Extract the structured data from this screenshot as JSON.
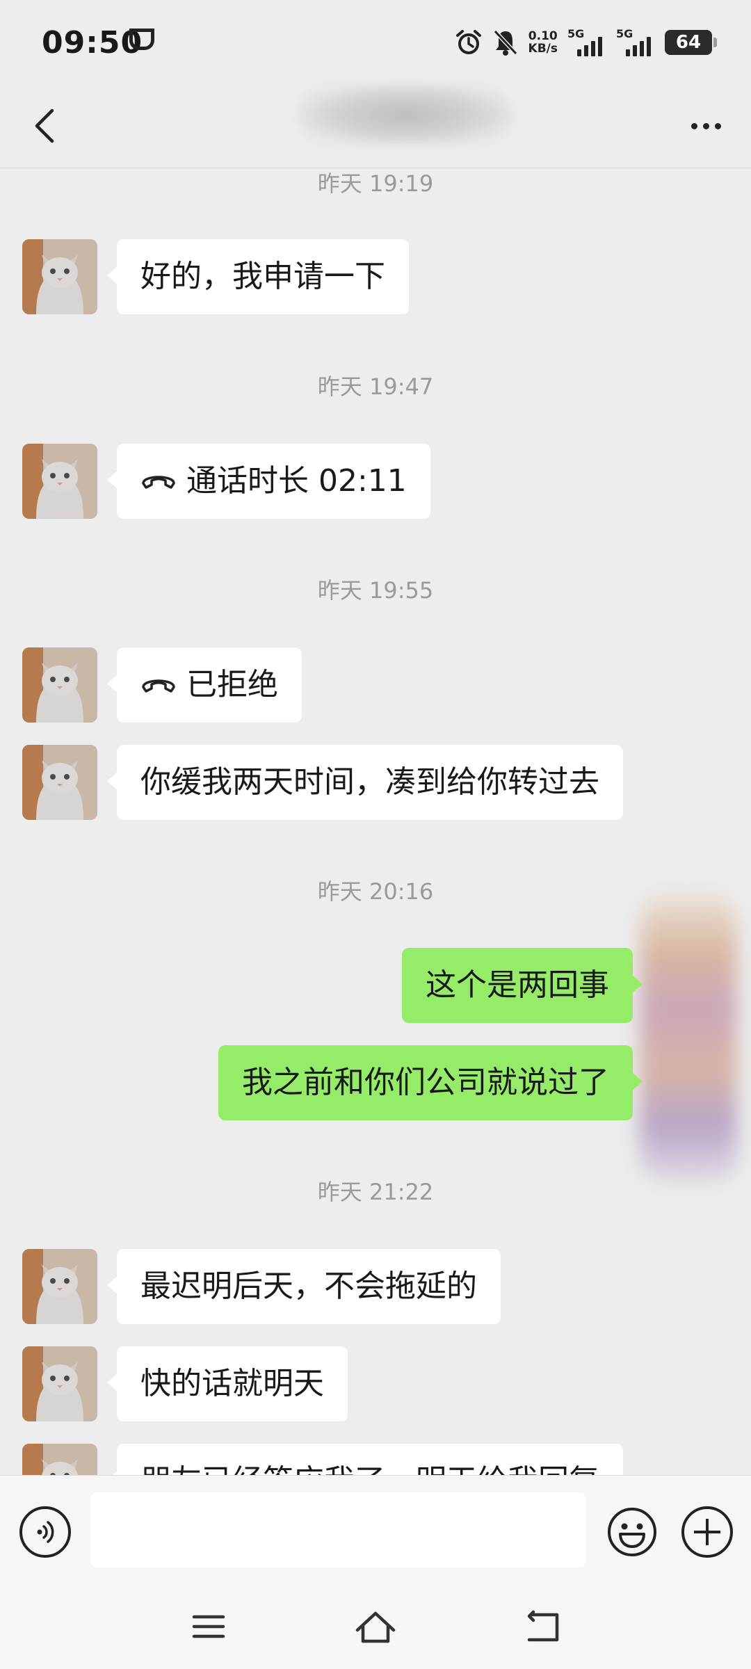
{
  "status_bar": {
    "time": "09:50",
    "net_speed_value": "0.10",
    "net_speed_unit": "KB/s",
    "sim1_label": "5G",
    "sim2_label": "5G",
    "battery": "64"
  },
  "header": {
    "contact_name": ""
  },
  "messages": [
    {
      "type": "timestamp",
      "text": "昨天 19:19"
    },
    {
      "type": "in",
      "text": "好的，我申请一下"
    },
    {
      "type": "timestamp",
      "text": "昨天 19:47"
    },
    {
      "type": "in-call",
      "text": "通话时长 02:11"
    },
    {
      "type": "timestamp",
      "text": "昨天 19:55"
    },
    {
      "type": "in-call",
      "text": "已拒绝"
    },
    {
      "type": "in",
      "text": "你缓我两天时间，凑到给你转过去"
    },
    {
      "type": "timestamp",
      "text": "昨天 20:16"
    },
    {
      "type": "out",
      "text": "这个是两回事"
    },
    {
      "type": "out",
      "text": "我之前和你们公司就说过了"
    },
    {
      "type": "timestamp",
      "text": "昨天 21:22"
    },
    {
      "type": "in",
      "text": "最迟明后天，不会拖延的"
    },
    {
      "type": "in",
      "text": "快的话就明天"
    },
    {
      "type": "in",
      "text": "朋友已经答应我了，明天给我回复"
    }
  ],
  "input_bar": {
    "placeholder": "",
    "value": ""
  },
  "icons": {
    "back": "chevron-left-icon",
    "more": "more-dots-icon",
    "voice": "voice-icon",
    "emoji": "emoji-icon",
    "plus": "plus-icon",
    "call": "phone-call-icon",
    "nav_menu": "menu-icon",
    "nav_home": "home-icon",
    "nav_back": "return-icon"
  },
  "colors": {
    "background": "#ededed",
    "bubble_incoming": "#ffffff",
    "bubble_outgoing": "#95ec69",
    "timestamp": "#9a9a9a"
  }
}
